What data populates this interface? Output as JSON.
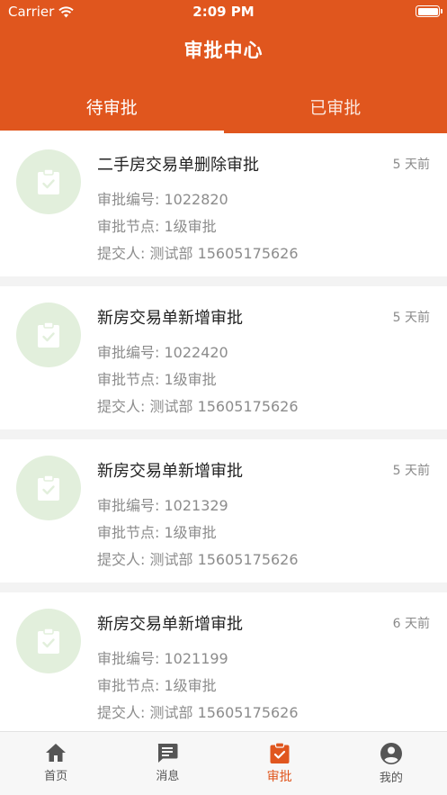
{
  "status_bar": {
    "carrier": "Carrier",
    "time": "2:09 PM"
  },
  "header": {
    "title": "审批中心",
    "tabs": [
      {
        "label": "待审批"
      },
      {
        "label": "已审批"
      }
    ]
  },
  "approvals": [
    {
      "title": "二手房交易单删除审批",
      "time": "5 天前",
      "number": "审批编号: 1022820",
      "node": "审批节点: 1级审批",
      "submitter": "提交人: 测试部 15605175626"
    },
    {
      "title": "新房交易单新增审批",
      "time": "5 天前",
      "number": "审批编号: 1022420",
      "node": "审批节点: 1级审批",
      "submitter": "提交人: 测试部 15605175626"
    },
    {
      "title": "新房交易单新增审批",
      "time": "5 天前",
      "number": "审批编号: 1021329",
      "node": "审批节点: 1级审批",
      "submitter": "提交人: 测试部 15605175626"
    },
    {
      "title": "新房交易单新增审批",
      "time": "6 天前",
      "number": "审批编号: 1021199",
      "node": "审批节点: 1级审批",
      "submitter": "提交人: 测试部 15605175626"
    }
  ],
  "tabbar": [
    {
      "label": "首页",
      "icon": "home-icon"
    },
    {
      "label": "消息",
      "icon": "message-icon"
    },
    {
      "label": "审批",
      "icon": "approval-icon"
    },
    {
      "label": "我的",
      "icon": "profile-icon"
    }
  ],
  "colors": {
    "accent": "#e0561e",
    "icon_circle": "#e2efdc",
    "icon_glyph": "#ffffff"
  }
}
